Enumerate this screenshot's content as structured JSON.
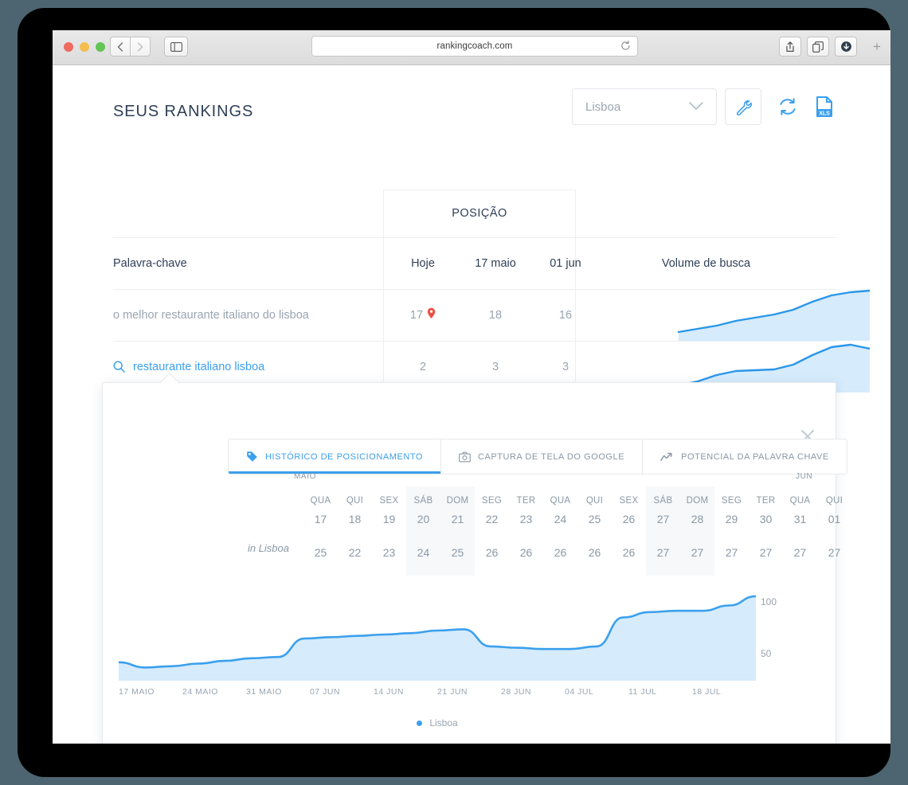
{
  "browser": {
    "url": "rankingcoach.com",
    "reload_icon": "reload-icon",
    "back_icon": "chevron-left-icon",
    "forward_icon": "chevron-right-icon",
    "sidebar_icon": "sidebar-icon",
    "share_icon": "share-icon",
    "tabs_icon": "tab-overview-icon",
    "downloads_icon": "download-icon",
    "newtab_label": "+"
  },
  "header": {
    "title": "SEUS RANKINGS",
    "city_value": "Lisboa",
    "chevron": "chevron-down-icon",
    "settings_icon": "wrench-icon",
    "refresh_icon": "refresh-icon",
    "export_icon": "xls-export-icon",
    "export_label": "XLS"
  },
  "table": {
    "group_header": "POSIÇÃO",
    "columns": {
      "keyword": "Palavra-chave",
      "today": "Hoje",
      "date_1": "17 maio",
      "date_2": "01 jun",
      "volume": "Volume de busca"
    },
    "rows": [
      {
        "keyword": "o melhor restaurante italiano do lisboa",
        "today": "17",
        "has_pin": true,
        "date_1": "18",
        "date_2": "16"
      },
      {
        "keyword": "restaurante italiano lisboa",
        "today": "2",
        "has_pin": false,
        "date_1": "3",
        "date_2": "3"
      }
    ]
  },
  "popup": {
    "close_icon": "close-icon",
    "tabs": [
      {
        "label": "HISTÓRICO DE POSICIONAMENTO",
        "icon": "tag-icon",
        "selected": true
      },
      {
        "label": "CAPTURA DE TELA DO GOOGLE",
        "icon": "camera-icon",
        "selected": false
      },
      {
        "label": "POTENCIAL DA PALAVRA CHAVE",
        "icon": "trend-up-icon",
        "selected": false
      }
    ],
    "calendar": {
      "month_left": "MAIO",
      "month_right": "JUN",
      "row_label": "in Lisboa",
      "days": [
        {
          "dow": "QUA",
          "dom": "17",
          "value": "25",
          "weekend": false
        },
        {
          "dow": "QUI",
          "dom": "18",
          "value": "22",
          "weekend": false
        },
        {
          "dow": "SEX",
          "dom": "19",
          "value": "23",
          "weekend": false
        },
        {
          "dow": "SÁB",
          "dom": "20",
          "value": "24",
          "weekend": true
        },
        {
          "dow": "DOM",
          "dom": "21",
          "value": "25",
          "weekend": true
        },
        {
          "dow": "SEG",
          "dom": "22",
          "value": "26",
          "weekend": false
        },
        {
          "dow": "TER",
          "dom": "23",
          "value": "26",
          "weekend": false
        },
        {
          "dow": "QUA",
          "dom": "24",
          "value": "26",
          "weekend": false
        },
        {
          "dow": "QUI",
          "dom": "25",
          "value": "26",
          "weekend": false
        },
        {
          "dow": "SEX",
          "dom": "26",
          "value": "26",
          "weekend": false
        },
        {
          "dow": "SÁB",
          "dom": "27",
          "value": "27",
          "weekend": true
        },
        {
          "dow": "DOM",
          "dom": "28",
          "value": "27",
          "weekend": true
        },
        {
          "dow": "SEG",
          "dom": "29",
          "value": "27",
          "weekend": false
        },
        {
          "dow": "TER",
          "dom": "30",
          "value": "27",
          "weekend": false
        },
        {
          "dow": "QUA",
          "dom": "31",
          "value": "27",
          "weekend": false
        },
        {
          "dow": "QUI",
          "dom": "01",
          "value": "27",
          "weekend": false
        }
      ]
    }
  },
  "chart_data": {
    "type": "area",
    "title": "",
    "xlabel": "",
    "ylabel": "",
    "grid": false,
    "legend_position": "bottom",
    "legend": [
      "Lisboa"
    ],
    "accent_color": "#3ba0ed",
    "fill_color": "#d6ebfb",
    "ylim": [
      40,
      110
    ],
    "yticks": [
      50,
      100
    ],
    "ytick_labels": [
      "50",
      "100"
    ],
    "xtick_labels": [
      "17 MAIO",
      "24 MAIO",
      "31 MAIO",
      "07 JUN",
      "14 JUN",
      "21 JUN",
      "28 JUN",
      "04 JUL",
      "11 JUL",
      "18 JUL"
    ],
    "series": [
      {
        "name": "Lisboa",
        "x": [
          "17 MAIO",
          "20 MAIO",
          "24 MAIO",
          "27 MAIO",
          "31 MAIO",
          "03 JUN",
          "06 JUN",
          "07 JUN",
          "09 JUN",
          "12 JUN",
          "14 JUN",
          "17 JUN",
          "19 JUN",
          "20 JUN",
          "21 JUN",
          "24 JUN",
          "28 JUN",
          "01 JUL",
          "02 JUL",
          "04 JUL",
          "06 JUL",
          "08 JUL",
          "11 JUL",
          "14 JUL",
          "18 JUL"
        ],
        "values": [
          54,
          50,
          51,
          53,
          55,
          57,
          58,
          72,
          73,
          74,
          75,
          76,
          78,
          79,
          66,
          65,
          64,
          64,
          66,
          88,
          92,
          93,
          93,
          97,
          104
        ]
      }
    ]
  },
  "sparklines": {
    "accent_color": "#2a96e8",
    "fill_color": "#d6ebfb",
    "rows": [
      {
        "values": [
          8,
          11,
          14,
          20,
          24,
          28,
          35,
          46,
          56,
          62,
          66
        ]
      },
      {
        "values": [
          6,
          10,
          18,
          25,
          26,
          27,
          33,
          45,
          56,
          62,
          58
        ]
      }
    ]
  }
}
